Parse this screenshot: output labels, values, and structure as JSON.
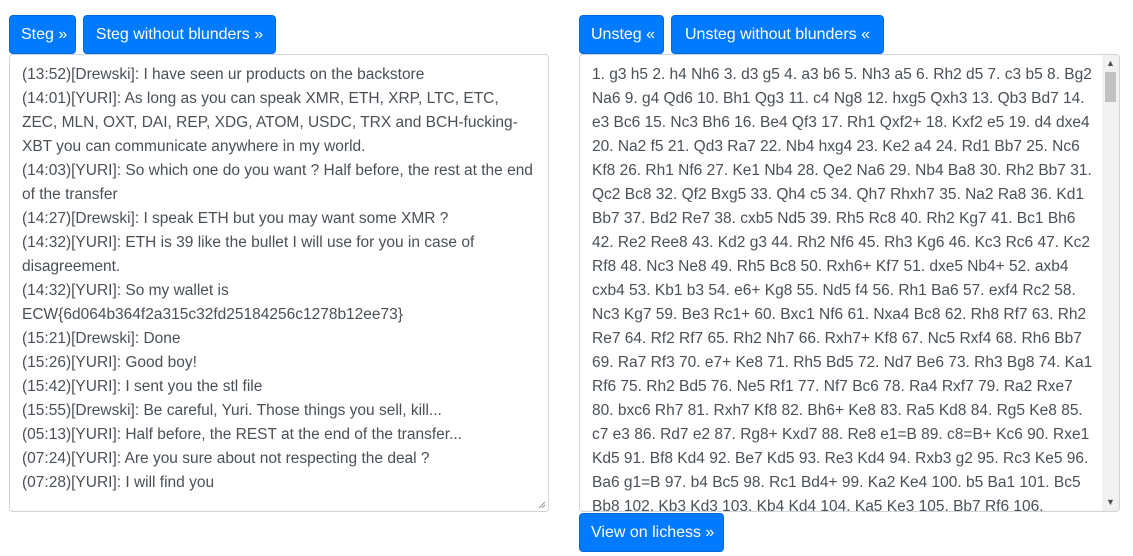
{
  "buttons": {
    "steg": "Steg »",
    "steg_no_blunders": "Steg without blunders »",
    "unsteg": "Unsteg «",
    "unsteg_no_blunders": "Unsteg without blunders «",
    "view_lichess": "View on lichess »"
  },
  "chat": {
    "lines": [
      "(13:52)[Drewski]: I have seen ur products on the backstore",
      "(14:01)[YURI]: As long as you can speak XMR, ETH, XRP, LTC, ETC, ZEC, MLN, OXT, DAI, REP, XDG, ATOM, USDC, TRX and BCH-fucking-XBT you can communicate anywhere in my world.",
      "(14:03)[YURI]: So which one do you want ? Half before, the rest at the end of the transfer",
      "(14:27)[Drewski]: I speak ETH but you may want some XMR ?",
      "(14:32)[YURI]: ETH is 39 like the bullet I will use for you in case of disagreement.",
      "(14:32)[YURI]: So my wallet is ECW{6d064b364f2a315c32fd25184256c1278b12ee73}",
      "(15:21)[Drewski]: Done",
      "(15:26)[YURI]: Good boy!",
      "(15:42)[YURI]: I sent you the stl file",
      "(15:55)[Drewski]: Be careful, Yuri. Those things you sell, kill...",
      "(05:13)[YURI]: Half before, the REST at the end of the transfer...",
      "(07:24)[YURI]: Are you sure about not respecting the deal ?",
      "(07:28)[YURI]: I will find you"
    ]
  },
  "moves": "1. g3 h5 2. h4 Nh6 3. d3 g5 4. a3 b6 5. Nh3 a5 6. Rh2 d5 7. c3 b5 8. Bg2 Na6 9. g4 Qd6 10. Bh1 Qg3 11. c4 Ng8 12. hxg5 Qxh3 13. Qb3 Bd7 14. e3 Bc6 15. Nc3 Bh6 16. Be4 Qf3 17. Rh1 Qxf2+ 18. Kxf2 e5 19. d4 dxe4 20. Na2 f5 21. Qd3 Ra7 22. Nb4 hxg4 23. Ke2 a4 24. Rd1 Bb7 25. Nc6 Kf8 26. Rh1 Nf6 27. Ke1 Nb4 28. Qe2 Na6 29. Nb4 Ba8 30. Rh2 Bb7 31. Qc2 Bc8 32. Qf2 Bxg5 33. Qh4 c5 34. Qh7 Rhxh7 35. Na2 Ra8 36. Kd1 Bb7 37. Bd2 Re7 38. cxb5 Nd5 39. Rh5 Rc8 40. Rh2 Kg7 41. Bc1 Bh6 42. Re2 Ree8 43. Kd2 g3 44. Rh2 Nf6 45. Rh3 Kg6 46. Kc3 Rc6 47. Kc2 Rf8 48. Nc3 Ne8 49. Rh5 Bc8 50. Rxh6+ Kf7 51. dxe5 Nb4+ 52. axb4 cxb4 53. Kb1 b3 54. e6+ Kg8 55. Nd5 f4 56. Rh1 Ba6 57. exf4 Rc2 58. Nc3 Kg7 59. Be3 Rc1+ 60. Bxc1 Nf6 61. Nxa4 Bc8 62. Rh8 Rf7 63. Rh2 Re7 64. Rf2 Rf7 65. Rh2 Nh7 66. Rxh7+ Kf8 67. Nc5 Rxf4 68. Rh6 Bb7 69. Ra7 Rf3 70. e7+ Ke8 71. Rh5 Bd5 72. Nd7 Be6 73. Rh3 Bg8 74. Ka1 Rf6 75. Rh2 Bd5 76. Ne5 Rf1 77. Nf7 Bc6 78. Ra4 Rxf7 79. Ra2 Rxe7 80. bxc6 Rh7 81. Rxh7 Kf8 82. Bh6+ Ke8 83. Ra5 Kd8 84. Rg5 Ke8 85. c7 e3 86. Rd7 e2 87. Rg8+ Kxd7 88. Re8 e1=B 89. c8=B+ Kc6 90. Rxe1 Kd5 91. Bf8 Kd4 92. Be7 Kd5 93. Re3 Kd4 94. Rxb3 g2 95. Rc3 Ke5 96. Ba6 g1=B 97. b4 Bc5 98. Rc1 Bd4+ 99. Ka2 Ke4 100. b5 Ba1 101. Bc5 Bb8 102. Kb3 Kd3 103. Kb4 Kd4 104. Ka5 Ke3 105. Bb7 Rf6 106."
}
